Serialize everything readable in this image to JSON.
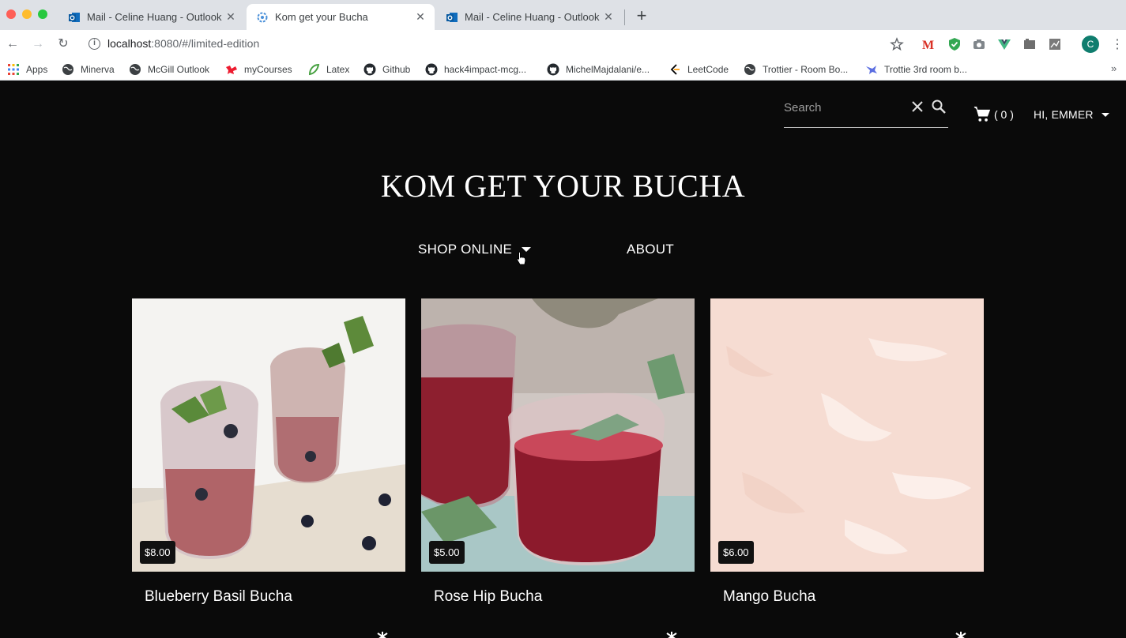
{
  "browser": {
    "tabs": [
      {
        "title": "Mail - Celine Huang - Outlook",
        "active": false
      },
      {
        "title": "Kom get your Bucha",
        "active": true
      },
      {
        "title": "Mail - Celine Huang - Outlook",
        "active": false
      }
    ],
    "url_host": "localhost",
    "url_path": ":8080/#/limited-edition",
    "avatar_letter": "C",
    "bookmarks": [
      {
        "label": "Apps"
      },
      {
        "label": "Minerva"
      },
      {
        "label": "McGill Outlook"
      },
      {
        "label": "myCourses"
      },
      {
        "label": "Latex"
      },
      {
        "label": "Github"
      },
      {
        "label": "hack4impact-mcg..."
      },
      {
        "label": "MichelMajdalani/e..."
      },
      {
        "label": "LeetCode"
      },
      {
        "label": "Trottier - Room Bo..."
      },
      {
        "label": "Trottie 3rd room b..."
      }
    ],
    "more_bookmarks": "»"
  },
  "header": {
    "search_placeholder": "Search",
    "cart_count": "( 0 )",
    "user_greeting": "HI, EMMER"
  },
  "brand": {
    "title": "KOM GET YOUR BUCHA"
  },
  "nav": {
    "shop": "SHOP ONLINE",
    "about": "ABOUT"
  },
  "products": [
    {
      "name": "Blueberry Basil Bucha",
      "price": "$8.00"
    },
    {
      "name": "Rose Hip Bucha",
      "price": "$5.00"
    },
    {
      "name": "Mango Bucha",
      "price": "$6.00"
    }
  ],
  "colors": {
    "page_bg": "#0a0a0a",
    "mango_bg": "#f6dcd2",
    "tab_bar": "#dee1e6"
  }
}
